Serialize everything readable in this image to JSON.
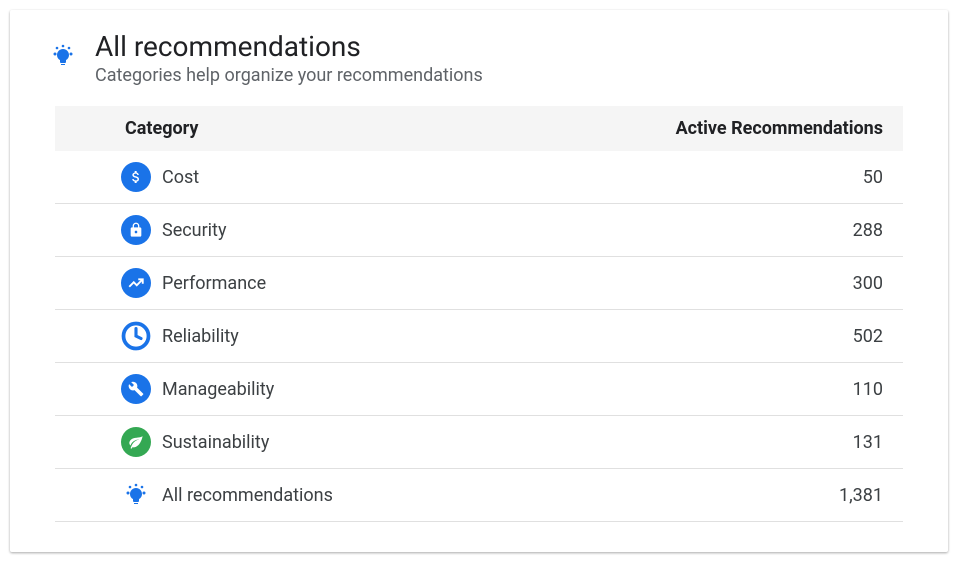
{
  "header": {
    "title": "All recommendations",
    "subtitle": "Categories help organize your recommendations"
  },
  "table": {
    "columns": {
      "category": "Category",
      "active": "Active Recommendations"
    },
    "rows": [
      {
        "icon": "dollar",
        "label": "Cost",
        "count": "50"
      },
      {
        "icon": "lock",
        "label": "Security",
        "count": "288"
      },
      {
        "icon": "trending",
        "label": "Performance",
        "count": "300"
      },
      {
        "icon": "clock",
        "label": "Reliability",
        "count": "502"
      },
      {
        "icon": "wrench",
        "label": "Manageability",
        "count": "110"
      },
      {
        "icon": "leaf",
        "label": "Sustainability",
        "count": "131"
      },
      {
        "icon": "lightbulb",
        "label": "All recommendations",
        "count": "1,381"
      }
    ]
  },
  "colors": {
    "blue": "#1a73e8",
    "green": "#34a853"
  }
}
